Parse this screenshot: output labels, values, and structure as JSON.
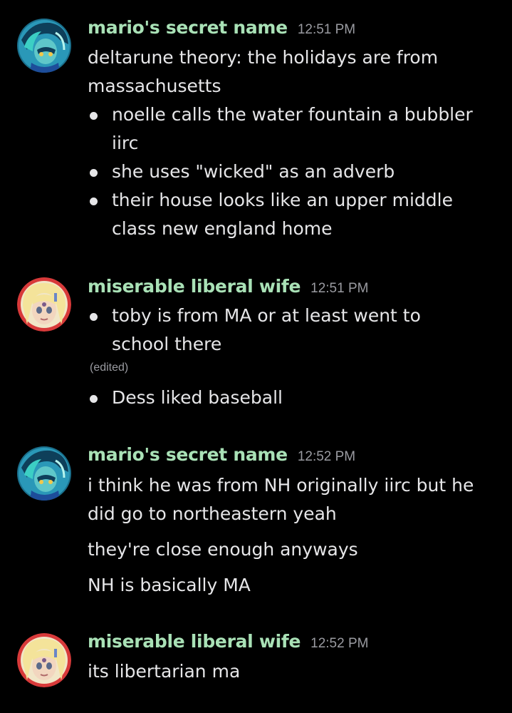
{
  "colors": {
    "background": "#000000",
    "username": "#a9e1b6",
    "text": "#e6e6e8",
    "timestamp": "#9a9ba1"
  },
  "messages": [
    {
      "username": "mario's secret name",
      "time": "12:51 PM",
      "avatar": "blue-haired-character-avatar",
      "intro": [
        "deltarune theory: the holidays are from",
        "massachusetts"
      ],
      "bullets": [
        [
          "noelle calls the water fountain a bubbler",
          "iirc"
        ],
        [
          "she uses \"wicked\" as an adverb"
        ],
        [
          "their house looks like an upper middle",
          "class new england home"
        ]
      ]
    },
    {
      "username": "miserable liberal wife",
      "time": "12:51 PM",
      "avatar": "blonde-character-avatar",
      "bullets": [
        [
          "toby is from MA or at least went to",
          "school there"
        ],
        [
          "Dess liked baseball"
        ]
      ],
      "edited": "(edited)"
    },
    {
      "username": "mario's secret name",
      "time": "12:52 PM",
      "avatar": "blue-haired-character-avatar",
      "lines": [
        [
          "i think he was from NH originally iirc but he",
          "did go to northeastern yeah"
        ],
        [
          "they're close enough anyways"
        ],
        [
          "NH is basically MA"
        ]
      ]
    },
    {
      "username": "miserable liberal wife",
      "time": "12:52 PM",
      "avatar": "blonde-character-avatar",
      "lines": [
        [
          "its libertarian ma"
        ]
      ]
    }
  ]
}
